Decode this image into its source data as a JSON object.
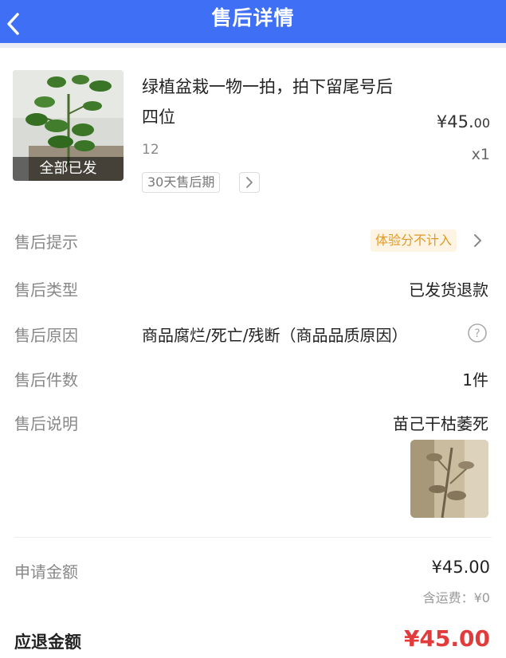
{
  "header": {
    "title": "售后详情",
    "back_icon": "back-arrow-icon"
  },
  "product": {
    "image_status": "全部已发",
    "name": "绿植盆栽一物一拍，拍下留尾号后四位",
    "price_main": "¥45.",
    "price_cents": "00",
    "spec": "12",
    "quantity": "x1",
    "aftersale_period": "30天售后期"
  },
  "details": {
    "tip": {
      "label": "售后提示",
      "value": "体验分不计入"
    },
    "type": {
      "label": "售后类型",
      "value": "已发货退款"
    },
    "reason": {
      "label": "售后原因",
      "value": "商品腐烂/死亡/残断（商品品质原因）"
    },
    "count": {
      "label": "售后件数",
      "value": "1件"
    },
    "note": {
      "label": "售后说明",
      "value": "苗己干枯萎死"
    }
  },
  "amounts": {
    "apply_label": "申请金额",
    "apply_value": "¥45.00",
    "shipping_note": "含运费：¥0",
    "refund_label": "应退金额",
    "refund_value": "¥45.00"
  },
  "colors": {
    "header_bg": "#3f6ff5",
    "refund_red": "#e23b3b",
    "badge_orange": "#e09a2a",
    "badge_bg": "#fdf4e3"
  }
}
